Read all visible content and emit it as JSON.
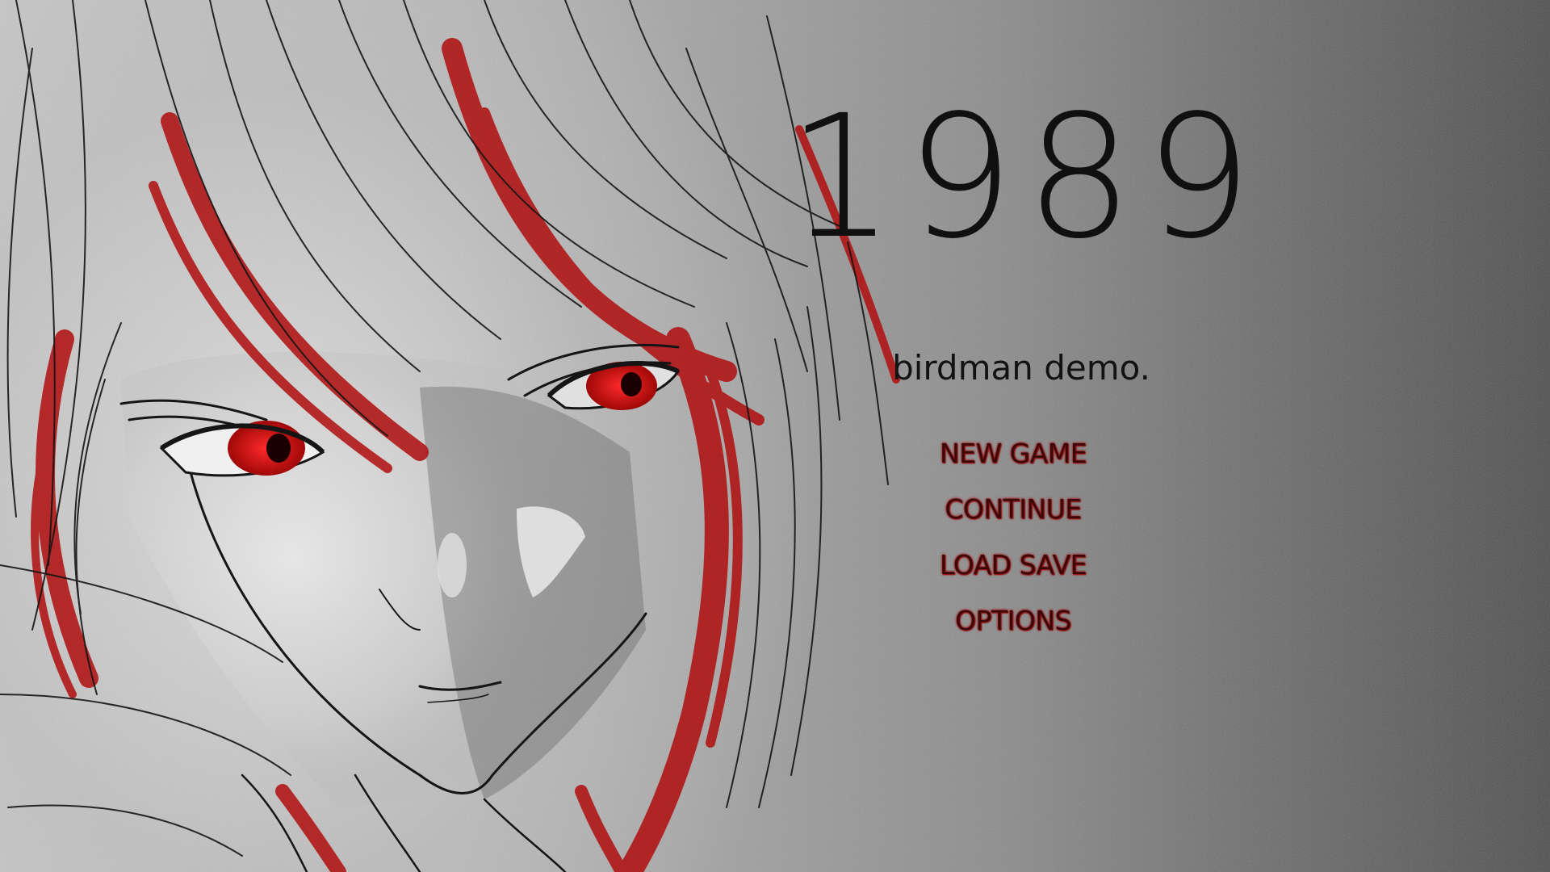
{
  "title": "1989",
  "subtitle": "birdman demo.",
  "menu": [
    {
      "id": "new-game",
      "label": "NEW GAME"
    },
    {
      "id": "continue",
      "label": "CONTINUE"
    },
    {
      "id": "load-save",
      "label": "LOAD SAVE"
    },
    {
      "id": "options",
      "label": "OPTIONS"
    }
  ],
  "colors": {
    "title_text": "#101010",
    "menu_text": "#3a0808",
    "menu_glow": "#b01515",
    "eye_red": "#c81414",
    "hair_red": "#b00d0d",
    "line_art": "#151515"
  }
}
